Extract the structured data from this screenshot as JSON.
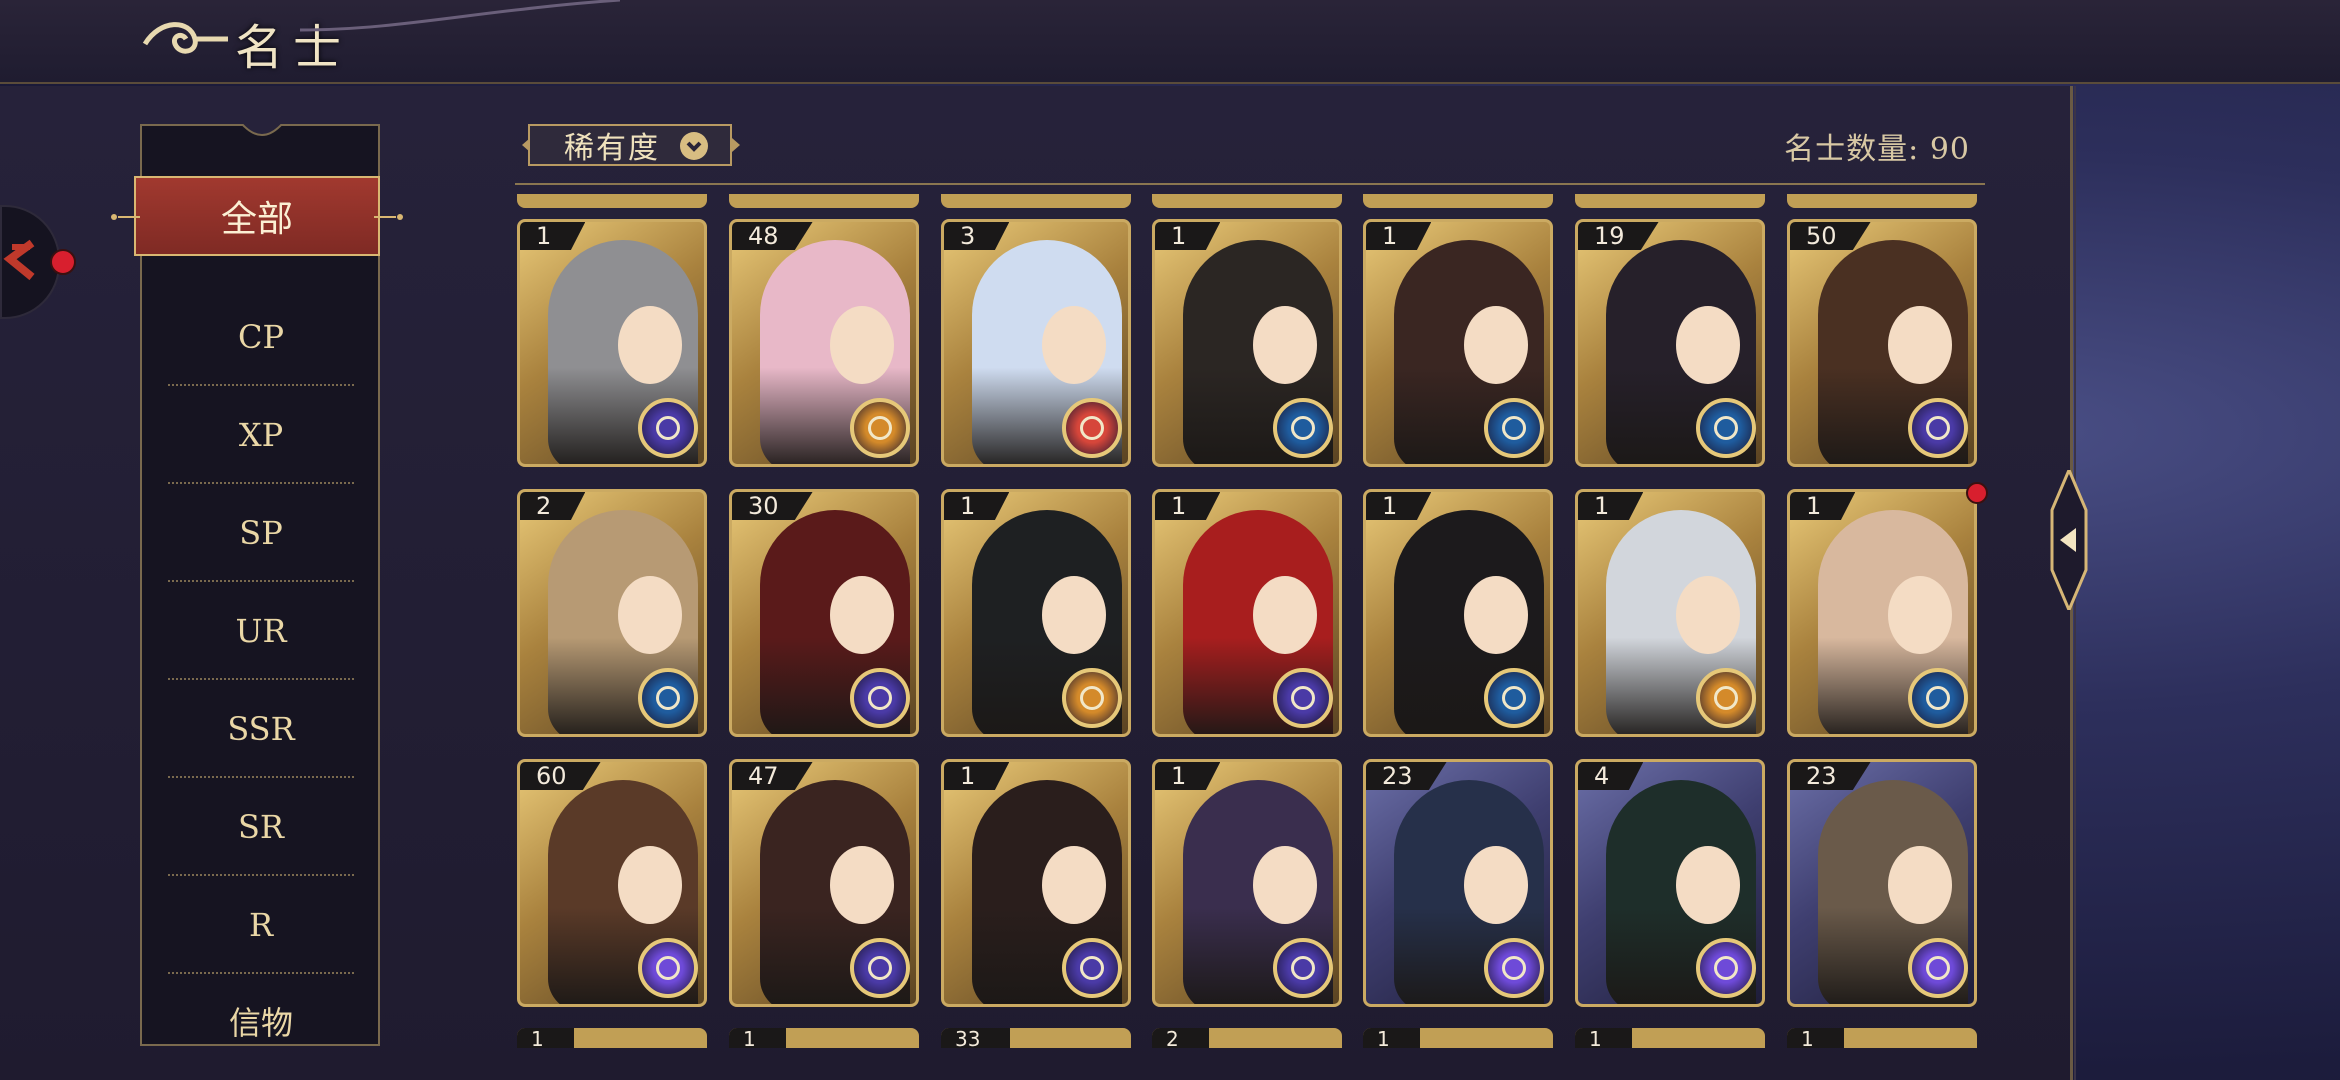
{
  "header": {
    "title": "名士"
  },
  "sidebar": {
    "items": [
      {
        "label": "全部",
        "active": true
      },
      {
        "label": "CP"
      },
      {
        "label": "XP"
      },
      {
        "label": "SP"
      },
      {
        "label": "UR"
      },
      {
        "label": "SSR"
      },
      {
        "label": "SR"
      },
      {
        "label": "R"
      },
      {
        "label": "信物"
      }
    ]
  },
  "filter": {
    "label": "稀有度",
    "icon": "chevron-down-icon"
  },
  "summary": {
    "count_label": "名士数量: 90"
  },
  "colors": {
    "accent_red": "#a1392f",
    "gold": "#cbaa62",
    "notification": "#d81f2e"
  },
  "cards": [
    {
      "level": "1",
      "badge": "purple",
      "hair": "#8f8f92",
      "bg": "gold"
    },
    {
      "level": "48",
      "badge": "orange",
      "hair": "#e8b8c8",
      "bg": "gold"
    },
    {
      "level": "3",
      "badge": "red",
      "hair": "#cfdcf0",
      "bg": "gold"
    },
    {
      "level": "1",
      "badge": "blue",
      "hair": "#2b2623",
      "bg": "gold"
    },
    {
      "level": "1",
      "badge": "blue",
      "hair": "#3a2622",
      "bg": "gold"
    },
    {
      "level": "19",
      "badge": "blue",
      "hair": "#26202a",
      "bg": "gold"
    },
    {
      "level": "50",
      "badge": "purple",
      "hair": "#4a3022",
      "bg": "gold"
    },
    {
      "level": "2",
      "badge": "blue",
      "hair": "#b79a74",
      "bg": "gold"
    },
    {
      "level": "30",
      "badge": "purple",
      "hair": "#5a1a1a",
      "bg": "gold"
    },
    {
      "level": "1",
      "badge": "orange",
      "hair": "#1e2022",
      "bg": "gold"
    },
    {
      "level": "1",
      "badge": "purple",
      "hair": "#a81e1e",
      "bg": "gold"
    },
    {
      "level": "1",
      "badge": "blue",
      "hair": "#1c1a1c",
      "bg": "gold"
    },
    {
      "level": "1",
      "badge": "orange",
      "hair": "#d2d6dc",
      "bg": "gold"
    },
    {
      "level": "1",
      "badge": "blue",
      "hair": "#d8b89e",
      "bg": "gold"
    },
    {
      "level": "60",
      "badge": "violet",
      "hair": "#5a3a28",
      "bg": "gold"
    },
    {
      "level": "47",
      "badge": "purple",
      "hair": "#3a2420",
      "bg": "gold"
    },
    {
      "level": "1",
      "badge": "purple",
      "hair": "#2a1e1c",
      "bg": "gold"
    },
    {
      "level": "1",
      "badge": "purple",
      "hair": "#3a2e4e",
      "bg": "gold"
    },
    {
      "level": "23",
      "badge": "violet",
      "hair": "#26304a",
      "bg": "dark"
    },
    {
      "level": "4",
      "badge": "violet",
      "hair": "#1e2e2a",
      "bg": "dark"
    },
    {
      "level": "23",
      "badge": "violet",
      "hair": "#6a5a4a",
      "bg": "dark"
    }
  ],
  "partial_row_levels": [
    "1",
    "1",
    "33",
    "2",
    "1",
    "1",
    "1"
  ],
  "badge_colors": {
    "purple": "#4a3aa6",
    "blue": "#1f5c9e",
    "orange": "#d48a2a",
    "red": "#d6463a",
    "violet": "#6e4ad8"
  }
}
